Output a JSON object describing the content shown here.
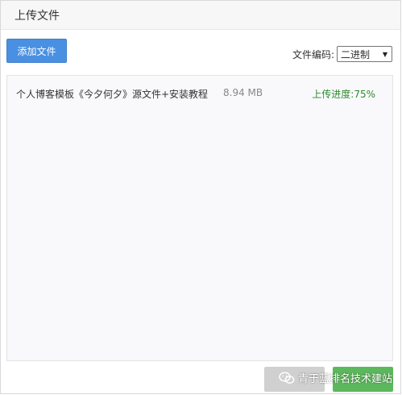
{
  "dialog": {
    "title": "上传文件"
  },
  "toolbar": {
    "add_label": "添加文件",
    "encoding_label": "文件编码:",
    "encoding_value": "二进制"
  },
  "files": [
    {
      "name": "个人博客模板《今夕何夕》源文件+安装教程",
      "size": "8.94 MB",
      "progress_label": "上传进度:75%",
      "progress_percent": 75
    }
  ],
  "watermark": {
    "text": "青于蓝排名技术建站",
    "icon": "wechat-icon"
  },
  "colors": {
    "primary": "#4a90e2",
    "success": "#5cb85c",
    "disabled": "#d0d0d0",
    "progress_text": "#2e8b2e"
  }
}
